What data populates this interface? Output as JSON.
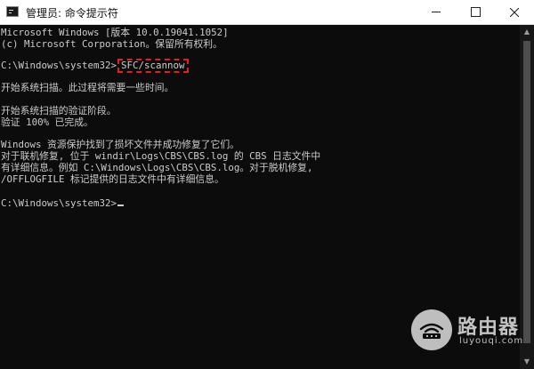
{
  "window": {
    "title": "管理员: 命令提示符"
  },
  "console": {
    "lines": [
      "Microsoft Windows [版本 10.0.19041.1052]",
      "(c) Microsoft Corporation。保留所有权利。",
      "",
      "C:\\Windows\\system32>",
      "",
      "开始系统扫描。此过程将需要一些时间。",
      "",
      "开始系统扫描的验证阶段。",
      "验证 100% 已完成。",
      "",
      "Windows 资源保护找到了损坏文件并成功修复了它们。",
      "对于联机修复, 位于 windir\\Logs\\CBS\\CBS.log 的 CBS 日志文件中",
      "有详细信息。例如 C:\\Windows\\Logs\\CBS\\CBS.log。对于脱机修复,",
      "/OFFLOGFILE 标记提供的日志文件中有详细信息。",
      "",
      "C:\\Windows\\system32>"
    ],
    "command": "SFC/scannow",
    "highlight_color": "#e3201b"
  },
  "watermark": {
    "title": "路由器",
    "url": "luyouqi.com"
  },
  "icons": {
    "app": "cmd-icon",
    "minimize": "minimize-icon",
    "maximize": "maximize-icon",
    "close": "close-icon",
    "watermark": "router-logo-icon"
  }
}
